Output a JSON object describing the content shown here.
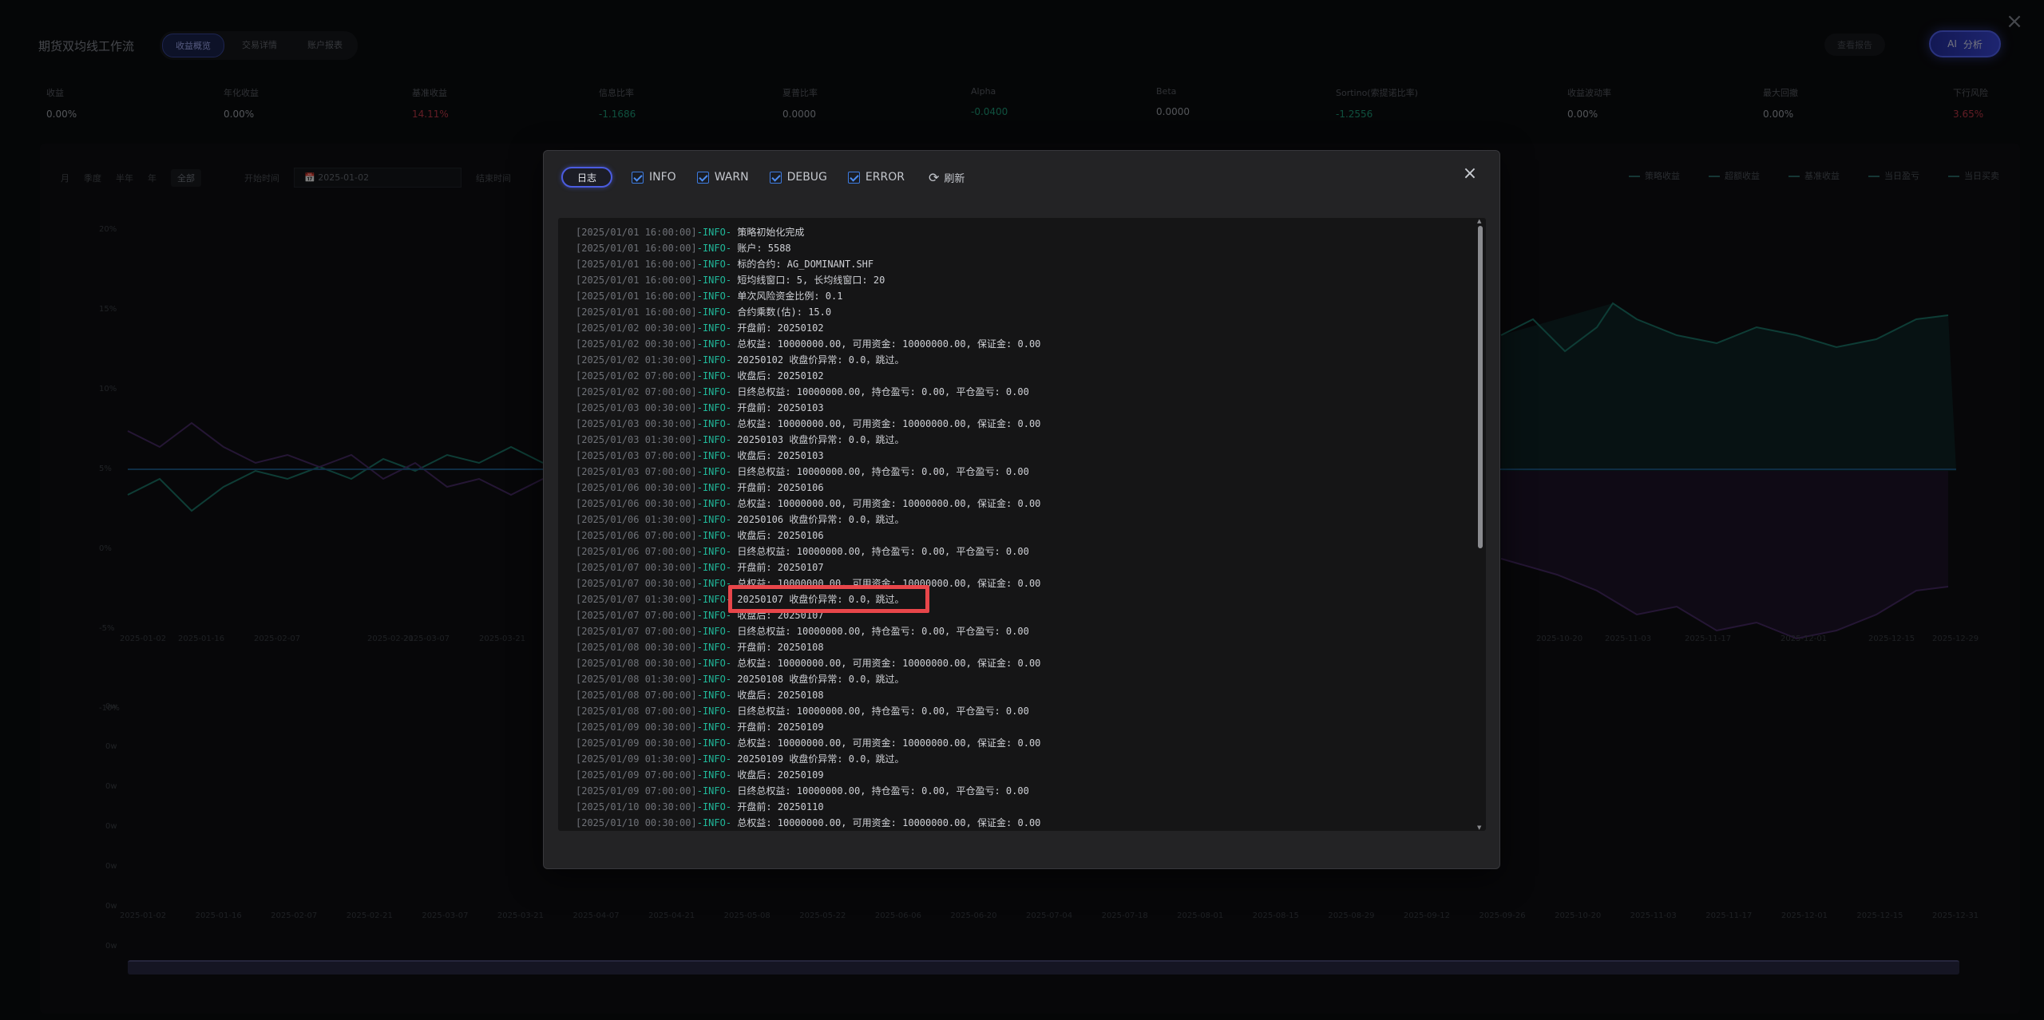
{
  "app": {
    "title": "期货双均线工作流",
    "tabs": [
      {
        "label": "收益概览",
        "active": true
      },
      {
        "label": "交易详情",
        "active": false
      },
      {
        "label": "账户报表",
        "active": false
      }
    ],
    "report_btn": "查看报告",
    "ai_btn": "分析",
    "ai_icon": "AI"
  },
  "metrics": [
    {
      "label": "收益",
      "value": "0.00%",
      "tone": "normal"
    },
    {
      "label": "年化收益",
      "value": "0.00%",
      "tone": "normal"
    },
    {
      "label": "基准收益",
      "value": "14.11%",
      "tone": "neg"
    },
    {
      "label": "信息比率",
      "value": "-1.1686",
      "tone": "pos"
    },
    {
      "label": "夏普比率",
      "value": "0.0000",
      "tone": "normal"
    },
    {
      "label": "Alpha",
      "value": "-0.0400",
      "tone": "pos"
    },
    {
      "label": "Beta",
      "value": "0.0000",
      "tone": "normal"
    },
    {
      "label": "Sortino(索提诺比率)",
      "value": "-1.2556",
      "tone": "pos"
    },
    {
      "label": "收益波动率",
      "value": "0.00%",
      "tone": "normal"
    },
    {
      "label": "最大回撤",
      "value": "0.00%",
      "tone": "normal"
    },
    {
      "label": "下行风险",
      "value": "3.65%",
      "tone": "neg"
    }
  ],
  "chart_toolbar": {
    "ranges": [
      "月",
      "季度",
      "半年",
      "年",
      "全部"
    ],
    "start_label": "开始时间",
    "start_value": "2025-01-02",
    "end_label": "结束时间"
  },
  "legend": [
    "策略收益",
    "超额收益",
    "基准收益",
    "当日盈亏",
    "当日买卖"
  ],
  "chart_axis": {
    "y_ticks": [
      "20%",
      "15%",
      "10%",
      "5%",
      "0%",
      "-5%",
      "-10%"
    ],
    "x_ticks_top": [
      "2025-01-02",
      "2025-01-16",
      "2025-02-07",
      "2025-02-21",
      "2025-03-07",
      "2025-03-21",
      "2025-10-20",
      "2025-11-03",
      "2025-11-17",
      "2025-12-01",
      "2025-12-15",
      "2025-12-29"
    ],
    "y_ticks_bottom": [
      "0w",
      "0w",
      "0w",
      "0w",
      "0w",
      "0w",
      "0w"
    ],
    "x_ticks_bottom": [
      "2025-01-02",
      "2025-01-16",
      "2025-02-07",
      "2025-02-21",
      "2025-03-07",
      "2025-03-21",
      "2025-04-07",
      "2025-04-21",
      "2025-05-08",
      "2025-05-22",
      "2025-06-06",
      "2025-06-20",
      "2025-07-04",
      "2025-07-18",
      "2025-08-01",
      "2025-08-15",
      "2025-08-29",
      "2025-09-12",
      "2025-09-26",
      "2025-10-20",
      "2025-11-03",
      "2025-11-17",
      "2025-12-01",
      "2025-12-15",
      "2025-12-31"
    ]
  },
  "log_modal": {
    "tab_label": "日志",
    "filters": [
      {
        "label": "INFO",
        "checked": true
      },
      {
        "label": "WARN",
        "checked": true
      },
      {
        "label": "DEBUG",
        "checked": true
      },
      {
        "label": "ERROR",
        "checked": true
      }
    ],
    "refresh_label": "刷新",
    "close_icon": "×",
    "lines": [
      {
        "ts": "[2025/01/01 16:00:00]",
        "lv": "-INFO-",
        "msg": "策略初始化完成"
      },
      {
        "ts": "[2025/01/01 16:00:00]",
        "lv": "-INFO-",
        "msg": "账户: 5588"
      },
      {
        "ts": "[2025/01/01 16:00:00]",
        "lv": "-INFO-",
        "msg": "标的合约: AG_DOMINANT.SHF"
      },
      {
        "ts": "[2025/01/01 16:00:00]",
        "lv": "-INFO-",
        "msg": "短均线窗口: 5, 长均线窗口: 20"
      },
      {
        "ts": "[2025/01/01 16:00:00]",
        "lv": "-INFO-",
        "msg": "单次风险资金比例: 0.1"
      },
      {
        "ts": "[2025/01/01 16:00:00]",
        "lv": "-INFO-",
        "msg": "合约乘数(估): 15.0"
      },
      {
        "ts": "[2025/01/02 00:30:00]",
        "lv": "-INFO-",
        "msg": "开盘前: 20250102"
      },
      {
        "ts": "[2025/01/02 00:30:00]",
        "lv": "-INFO-",
        "msg": "总权益: 10000000.00, 可用资金: 10000000.00, 保证金: 0.00"
      },
      {
        "ts": "[2025/01/02 01:30:00]",
        "lv": "-INFO-",
        "msg": "20250102 收盘价异常: 0.0，跳过。"
      },
      {
        "ts": "[2025/01/02 07:00:00]",
        "lv": "-INFO-",
        "msg": "收盘后: 20250102"
      },
      {
        "ts": "[2025/01/02 07:00:00]",
        "lv": "-INFO-",
        "msg": "日终总权益: 10000000.00, 持仓盈亏: 0.00, 平仓盈亏: 0.00"
      },
      {
        "ts": "[2025/01/03 00:30:00]",
        "lv": "-INFO-",
        "msg": "开盘前: 20250103"
      },
      {
        "ts": "[2025/01/03 00:30:00]",
        "lv": "-INFO-",
        "msg": "总权益: 10000000.00, 可用资金: 10000000.00, 保证金: 0.00"
      },
      {
        "ts": "[2025/01/03 01:30:00]",
        "lv": "-INFO-",
        "msg": "20250103 收盘价异常: 0.0，跳过。"
      },
      {
        "ts": "[2025/01/03 07:00:00]",
        "lv": "-INFO-",
        "msg": "收盘后: 20250103"
      },
      {
        "ts": "[2025/01/03 07:00:00]",
        "lv": "-INFO-",
        "msg": "日终总权益: 10000000.00, 持仓盈亏: 0.00, 平仓盈亏: 0.00"
      },
      {
        "ts": "[2025/01/06 00:30:00]",
        "lv": "-INFO-",
        "msg": "开盘前: 20250106"
      },
      {
        "ts": "[2025/01/06 00:30:00]",
        "lv": "-INFO-",
        "msg": "总权益: 10000000.00, 可用资金: 10000000.00, 保证金: 0.00"
      },
      {
        "ts": "[2025/01/06 01:30:00]",
        "lv": "-INFO-",
        "msg": "20250106 收盘价异常: 0.0，跳过。"
      },
      {
        "ts": "[2025/01/06 07:00:00]",
        "lv": "-INFO-",
        "msg": "收盘后: 20250106"
      },
      {
        "ts": "[2025/01/06 07:00:00]",
        "lv": "-INFO-",
        "msg": "日终总权益: 10000000.00, 持仓盈亏: 0.00, 平仓盈亏: 0.00"
      },
      {
        "ts": "[2025/01/07 00:30:00]",
        "lv": "-INFO-",
        "msg": "开盘前: 20250107"
      },
      {
        "ts": "[2025/01/07 00:30:00]",
        "lv": "-INFO-",
        "msg": "总权益: 10000000.00, 可用资金: 10000000.00, 保证金: 0.00"
      },
      {
        "ts": "[2025/01/07 01:30:00]",
        "lv": "-INFO-",
        "msg": "20250107 收盘价异常: 0.0，跳过。"
      },
      {
        "ts": "[2025/01/07 07:00:00]",
        "lv": "-INFO-",
        "msg": "收盘后: 20250107"
      },
      {
        "ts": "[2025/01/07 07:00:00]",
        "lv": "-INFO-",
        "msg": "日终总权益: 10000000.00, 持仓盈亏: 0.00, 平仓盈亏: 0.00"
      },
      {
        "ts": "[2025/01/08 00:30:00]",
        "lv": "-INFO-",
        "msg": "开盘前: 20250108"
      },
      {
        "ts": "[2025/01/08 00:30:00]",
        "lv": "-INFO-",
        "msg": "总权益: 10000000.00, 可用资金: 10000000.00, 保证金: 0.00"
      },
      {
        "ts": "[2025/01/08 01:30:00]",
        "lv": "-INFO-",
        "msg": "20250108 收盘价异常: 0.0，跳过。"
      },
      {
        "ts": "[2025/01/08 07:00:00]",
        "lv": "-INFO-",
        "msg": "收盘后: 20250108"
      },
      {
        "ts": "[2025/01/08 07:00:00]",
        "lv": "-INFO-",
        "msg": "日终总权益: 10000000.00, 持仓盈亏: 0.00, 平仓盈亏: 0.00"
      },
      {
        "ts": "[2025/01/09 00:30:00]",
        "lv": "-INFO-",
        "msg": "开盘前: 20250109"
      },
      {
        "ts": "[2025/01/09 00:30:00]",
        "lv": "-INFO-",
        "msg": "总权益: 10000000.00, 可用资金: 10000000.00, 保证金: 0.00"
      },
      {
        "ts": "[2025/01/09 01:30:00]",
        "lv": "-INFO-",
        "msg": "20250109 收盘价异常: 0.0，跳过。"
      },
      {
        "ts": "[2025/01/09 07:00:00]",
        "lv": "-INFO-",
        "msg": "收盘后: 20250109"
      },
      {
        "ts": "[2025/01/09 07:00:00]",
        "lv": "-INFO-",
        "msg": "日终总权益: 10000000.00, 持仓盈亏: 0.00, 平仓盈亏: 0.00"
      },
      {
        "ts": "[2025/01/10 00:30:00]",
        "lv": "-INFO-",
        "msg": "开盘前: 20250110"
      },
      {
        "ts": "[2025/01/10 00:30:00]",
        "lv": "-INFO-",
        "msg": "总权益: 10000000.00, 可用资金: 10000000.00, 保证金: 0.00"
      }
    ]
  },
  "colors": {
    "accent": "#4b5ce0",
    "info_level": "#20b89a",
    "highlight": "#e8464a"
  }
}
